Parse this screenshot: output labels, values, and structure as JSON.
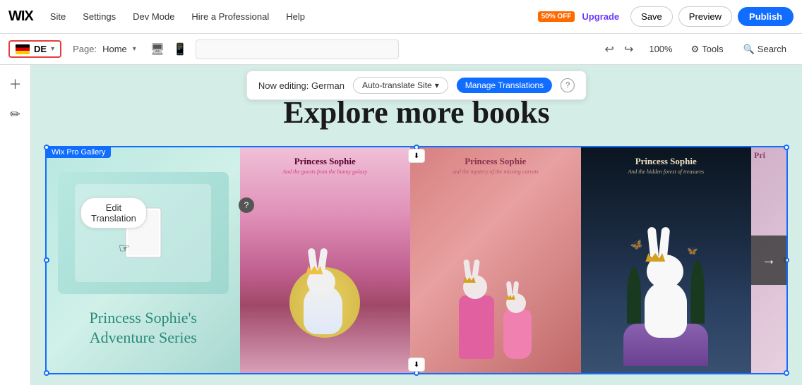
{
  "topbar": {
    "logo": "WIX",
    "nav": [
      "Site",
      "Settings",
      "Dev Mode",
      "Hire a Professional",
      "Help"
    ],
    "upgrade_badge": "50% OFF",
    "upgrade_label": "Upgrade",
    "save_label": "Save",
    "preview_label": "Preview",
    "publish_label": "Publish"
  },
  "secondbar": {
    "lang_code": "DE",
    "page_label": "Page:",
    "page_name": "Home",
    "zoom": "100%",
    "tools_label": "Tools",
    "search_label": "Search"
  },
  "translation_bar": {
    "now_editing": "Now editing: German",
    "auto_translate_label": "Auto-translate Site",
    "manage_translations_label": "Manage Translations"
  },
  "canvas": {
    "heading": "Explore more books",
    "gallery_label": "Wix Pro Gallery",
    "edit_translation_label": "Edit Translation",
    "series_title_line1": "Princess Sophie's",
    "series_title_line2": "Adventure Series",
    "book1_title": "Princess Sophie",
    "book1_subtitle": "And the guests from the bunny galaxy",
    "book2_title": "Princess Sophie",
    "book2_subtitle": "and the mystery of the missing carrots",
    "book3_title": "Princess Sophie",
    "book3_subtitle": "And the hidden forest of treasures",
    "book4_title": "Pri"
  },
  "icons": {
    "chevron_down": "▾",
    "desktop": "🖥",
    "mobile": "📱",
    "undo": "↩",
    "redo": "↪",
    "tools": "⚙",
    "search": "🔍",
    "arrow_right": "→",
    "download": "⬇",
    "help": "?",
    "edit_icon": "✏",
    "sidebar_add": "+",
    "sidebar_edit": "✏"
  },
  "colors": {
    "accent_blue": "#116dff",
    "red_border": "#e53e3e",
    "upgrade_orange": "#ff6a00",
    "upgrade_purple": "#6c3aff"
  }
}
